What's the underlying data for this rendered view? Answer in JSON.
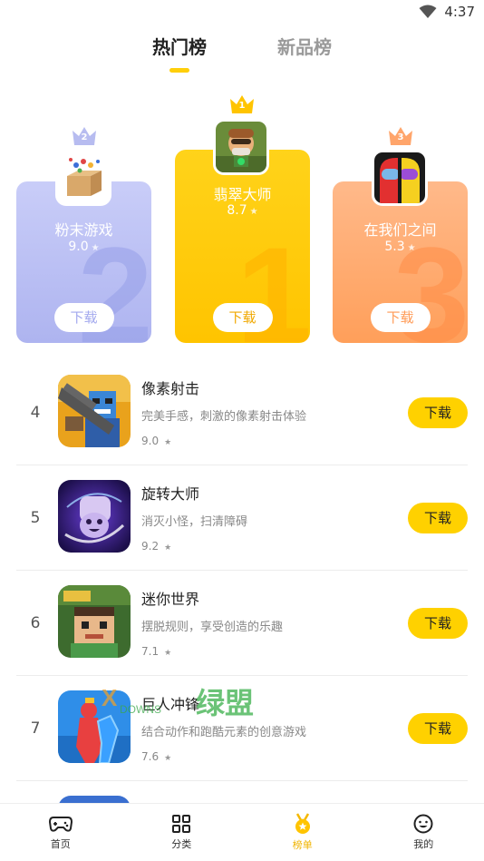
{
  "status_bar": {
    "time": "4:37"
  },
  "tabs": [
    {
      "label": "热门榜",
      "active": true
    },
    {
      "label": "新品榜",
      "active": false
    }
  ],
  "podium": [
    {
      "rank": "2",
      "name": "粉末游戏",
      "score": "9.0",
      "download_label": "下载",
      "color": "#b3b9f2"
    },
    {
      "rank": "1",
      "name": "翡翠大师",
      "score": "8.7",
      "download_label": "下载",
      "color": "#ffc90a"
    },
    {
      "rank": "3",
      "name": "在我们之间",
      "score": "5.3",
      "download_label": "下载",
      "color": "#ffa76a"
    }
  ],
  "list": [
    {
      "rank": "4",
      "name": "像素射击",
      "desc": "完美手感，刺激的像素射击体验",
      "score": "9.0",
      "download_label": "下载"
    },
    {
      "rank": "5",
      "name": "旋转大师",
      "desc": "消灭小怪，扫清障碍",
      "score": "9.2",
      "download_label": "下载"
    },
    {
      "rank": "6",
      "name": "迷你世界",
      "desc": "摆脱规则，享受创造的乐趣",
      "score": "7.1",
      "download_label": "下载"
    },
    {
      "rank": "7",
      "name": "巨人冲锋",
      "desc": "结合动作和跑酷元素的创意游戏",
      "score": "7.6",
      "download_label": "下载"
    }
  ],
  "watermark": {
    "text": "绿盟",
    "sub_text": "XDOWNS"
  },
  "bottom_nav": [
    {
      "label": "首页",
      "icon": "gamepad-icon",
      "active": false
    },
    {
      "label": "分类",
      "icon": "grid-icon",
      "active": false
    },
    {
      "label": "榜单",
      "icon": "medal-icon",
      "active": true
    },
    {
      "label": "我的",
      "icon": "smile-icon",
      "active": false
    }
  ],
  "colors": {
    "accent": "#ffd100",
    "rank2": "#b3b9f2",
    "rank1": "#ffc90a",
    "rank3": "#ffa76a"
  }
}
